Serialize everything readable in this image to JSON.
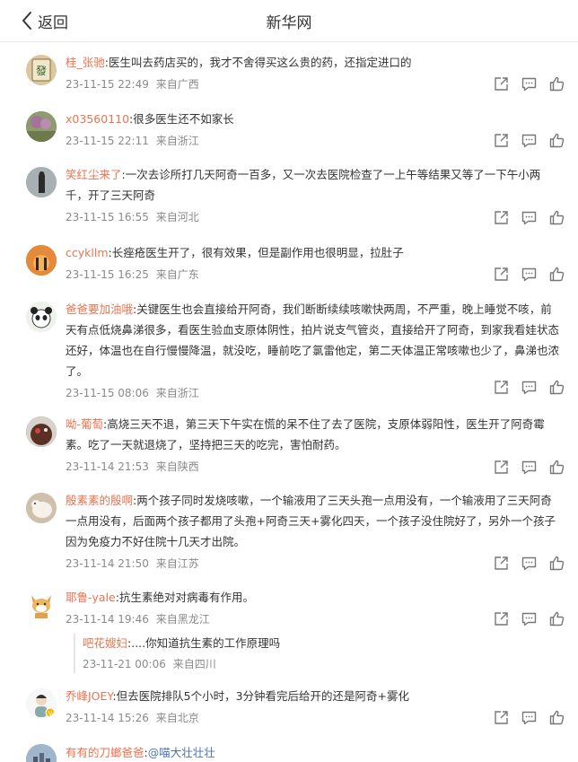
{
  "header": {
    "back_label": "返回",
    "title": "新华网"
  },
  "comments": [
    {
      "user": "桂_张驰",
      "sep": ":",
      "text": "医生叫去药店买的，我才不舍得买这么贵的药，还指定进口的",
      "time": "23-11-15 22:49",
      "loc": "来自广西"
    },
    {
      "user": "x03560110",
      "sep": ":",
      "text": "很多医生还不如家长",
      "time": "23-11-15 22:11",
      "loc": "来自浙江"
    },
    {
      "user": "笑红尘来了",
      "sep": ":",
      "text": "一次去诊所打几天阿奇一百多，又一次去医院检查了一上午等结果又等了一下午小两千，开了三天阿奇",
      "time": "23-11-15 16:55",
      "loc": "来自河北"
    },
    {
      "user": "ccykllm",
      "sep": ":",
      "text": "长痤疮医生开了，很有效果，但是副作用也很明显，拉肚子",
      "time": "23-11-15 16:25",
      "loc": "来自广东"
    },
    {
      "user": "爸爸要加油哦",
      "sep": ":",
      "text": "关键医生也会直接给开阿奇，我们断断续续咳嗽快两周，不严重，晚上睡觉不咳，前天有点低烧鼻涕很多，看医生验血支原体阴性，拍片说支气管炎，直接给开了阿奇，到家我看娃状态还好，体温也在自行慢慢降温，就没吃，睡前吃了氯雷他定，第二天体温正常咳嗽也少了，鼻涕也浓了。",
      "time": "23-11-15 08:06",
      "loc": "来自浙江"
    },
    {
      "user": "呦-葡萄",
      "sep": ":",
      "text": "高烧三天不退，第三天下午实在慌的呆不住了去了医院，支原体弱阳性，医生开了阿奇霉素。吃了一天就退烧了，坚持把三天的吃完，害怕耐药。",
      "time": "23-11-14 21:53",
      "loc": "来自陕西"
    },
    {
      "user": "殷素素的殷啊",
      "sep": ":",
      "text": "两个孩子同时发烧咳嗽，一个输液用了三天头孢一点用没有，一个输液用了三天阿奇一点用没有，后面两个孩子都用了头孢+阿奇三天+雾化四天，一个孩子没住院好了，另外一个孩子因为免疫力不好住院十几天才出院。",
      "time": "23-11-14 21:50",
      "loc": "来自江苏"
    },
    {
      "user": "耶鲁-yale",
      "sep": ":",
      "text": "抗生素绝对对病毒有作用。",
      "time": "23-11-14 19:46",
      "loc": "来自黑龙江",
      "reply": {
        "user": "吧花嫂妇",
        "sep": ":",
        "text": "....你知道抗生素的工作原理吗",
        "time": "23-11-21 00:06",
        "loc": "来自四川"
      }
    },
    {
      "user": "乔峰JOEY",
      "sep": ":",
      "text": "但去医院排队5个小时，3分钟看完后给开的还是阿奇+雾化",
      "time": "23-11-14 15:26",
      "loc": "来自北京"
    },
    {
      "user": "有有的刀螂爸爸",
      "sep": ":",
      "text": "@喵大壮壮壮",
      "time": "",
      "loc": ""
    }
  ]
}
